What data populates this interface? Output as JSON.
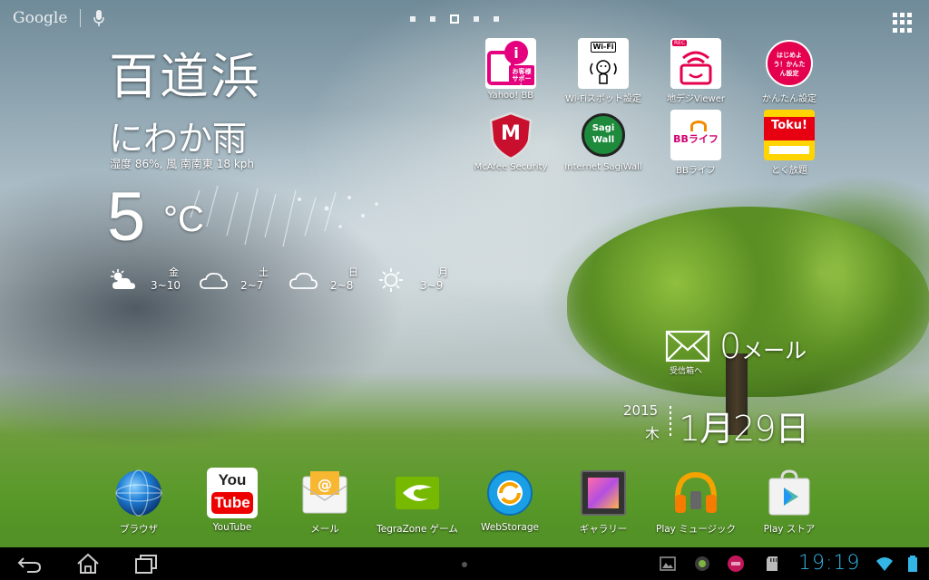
{
  "search_bar": {
    "logo": "Google"
  },
  "weather": {
    "city": "百道浜",
    "condition": "にわか雨",
    "detail": "湿度 86%, 風 南南東 18 kph",
    "temperature": "5",
    "unit": "°C",
    "forecast": [
      {
        "day": "金",
        "range": "3~10",
        "icon": "partly-sunny-icon"
      },
      {
        "day": "土",
        "range": "2~7",
        "icon": "cloudy-icon"
      },
      {
        "day": "日",
        "range": "2~8",
        "icon": "cloudy-icon"
      },
      {
        "day": "月",
        "range": "3~9",
        "icon": "sunny-icon"
      }
    ]
  },
  "apps": [
    {
      "label": "Yahoo! BB",
      "tile_text": "お客様サポート",
      "color": "#e5007e"
    },
    {
      "label": "Wi-Fiスポット設定",
      "tile_text": "Wi-Fi",
      "color": "#ffffff"
    },
    {
      "label": "地デジViewer",
      "tile_text": "REC",
      "color": "#e5004f"
    },
    {
      "label": "かんたん設定",
      "tile_text": "はじめよう！かんたん設定",
      "color": "#e5004f"
    },
    {
      "label": "McAfee Security",
      "tile_text": "M",
      "color": "#c8102e"
    },
    {
      "label": "Internet SagiWall",
      "tile_text": "Sagi Wall",
      "color": "#1e8a3c"
    },
    {
      "label": "BBライフ",
      "tile_text": "BBライフ",
      "color": "#ffffff"
    },
    {
      "label": "とく放題",
      "tile_text": "Toku!",
      "color": "#ffd400"
    }
  ],
  "dock": [
    {
      "label": "ブラウザ"
    },
    {
      "label": "YouTube",
      "tile_text_top": "You",
      "tile_text_bottom": "Tube"
    },
    {
      "label": "メール"
    },
    {
      "label": "TegraZone ゲーム"
    },
    {
      "label": "WebStorage"
    },
    {
      "label": "ギャラリー"
    },
    {
      "label": "Play ミュージック"
    },
    {
      "label": "Play ストア"
    }
  ],
  "mail_widget": {
    "count": "0",
    "unit": "メール",
    "inbox": "受信箱へ"
  },
  "date_widget": {
    "year": "2015",
    "weekday": "木",
    "date": "1月29日"
  },
  "status_bar": {
    "time": "19:19",
    "accent": "#33b5e5"
  }
}
